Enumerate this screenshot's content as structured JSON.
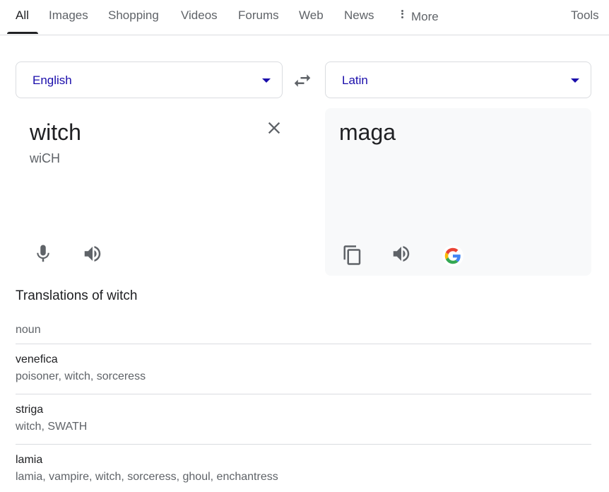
{
  "nav": {
    "tabs": [
      "All",
      "Images",
      "Shopping",
      "Videos",
      "Forums",
      "Web",
      "News"
    ],
    "more_label": "More",
    "tools_label": "Tools"
  },
  "translator": {
    "source_language": "English",
    "target_language": "Latin",
    "source_text": "witch",
    "source_phonetic": "wiCH",
    "target_text": "maga"
  },
  "translations": {
    "title": "Translations of witch",
    "part_of_speech": "noun",
    "entries": [
      {
        "word": "venefica",
        "synonyms": "poisoner, witch, sorceress"
      },
      {
        "word": "striga",
        "synonyms": "witch, SWATH"
      },
      {
        "word": "lamia",
        "synonyms": "lamia, vampire, witch, sorceress, ghoul, enchantress"
      }
    ]
  },
  "colors": {
    "link_blue": "#1a0dab",
    "icon_gray": "#5f6368",
    "divider": "#dadce0",
    "panel_bg": "#f8f9fa"
  },
  "icons": [
    "close-icon",
    "swap-icon",
    "microphone-icon",
    "speaker-icon",
    "copy-icon",
    "google-logo-icon",
    "more-vert-icon"
  ]
}
